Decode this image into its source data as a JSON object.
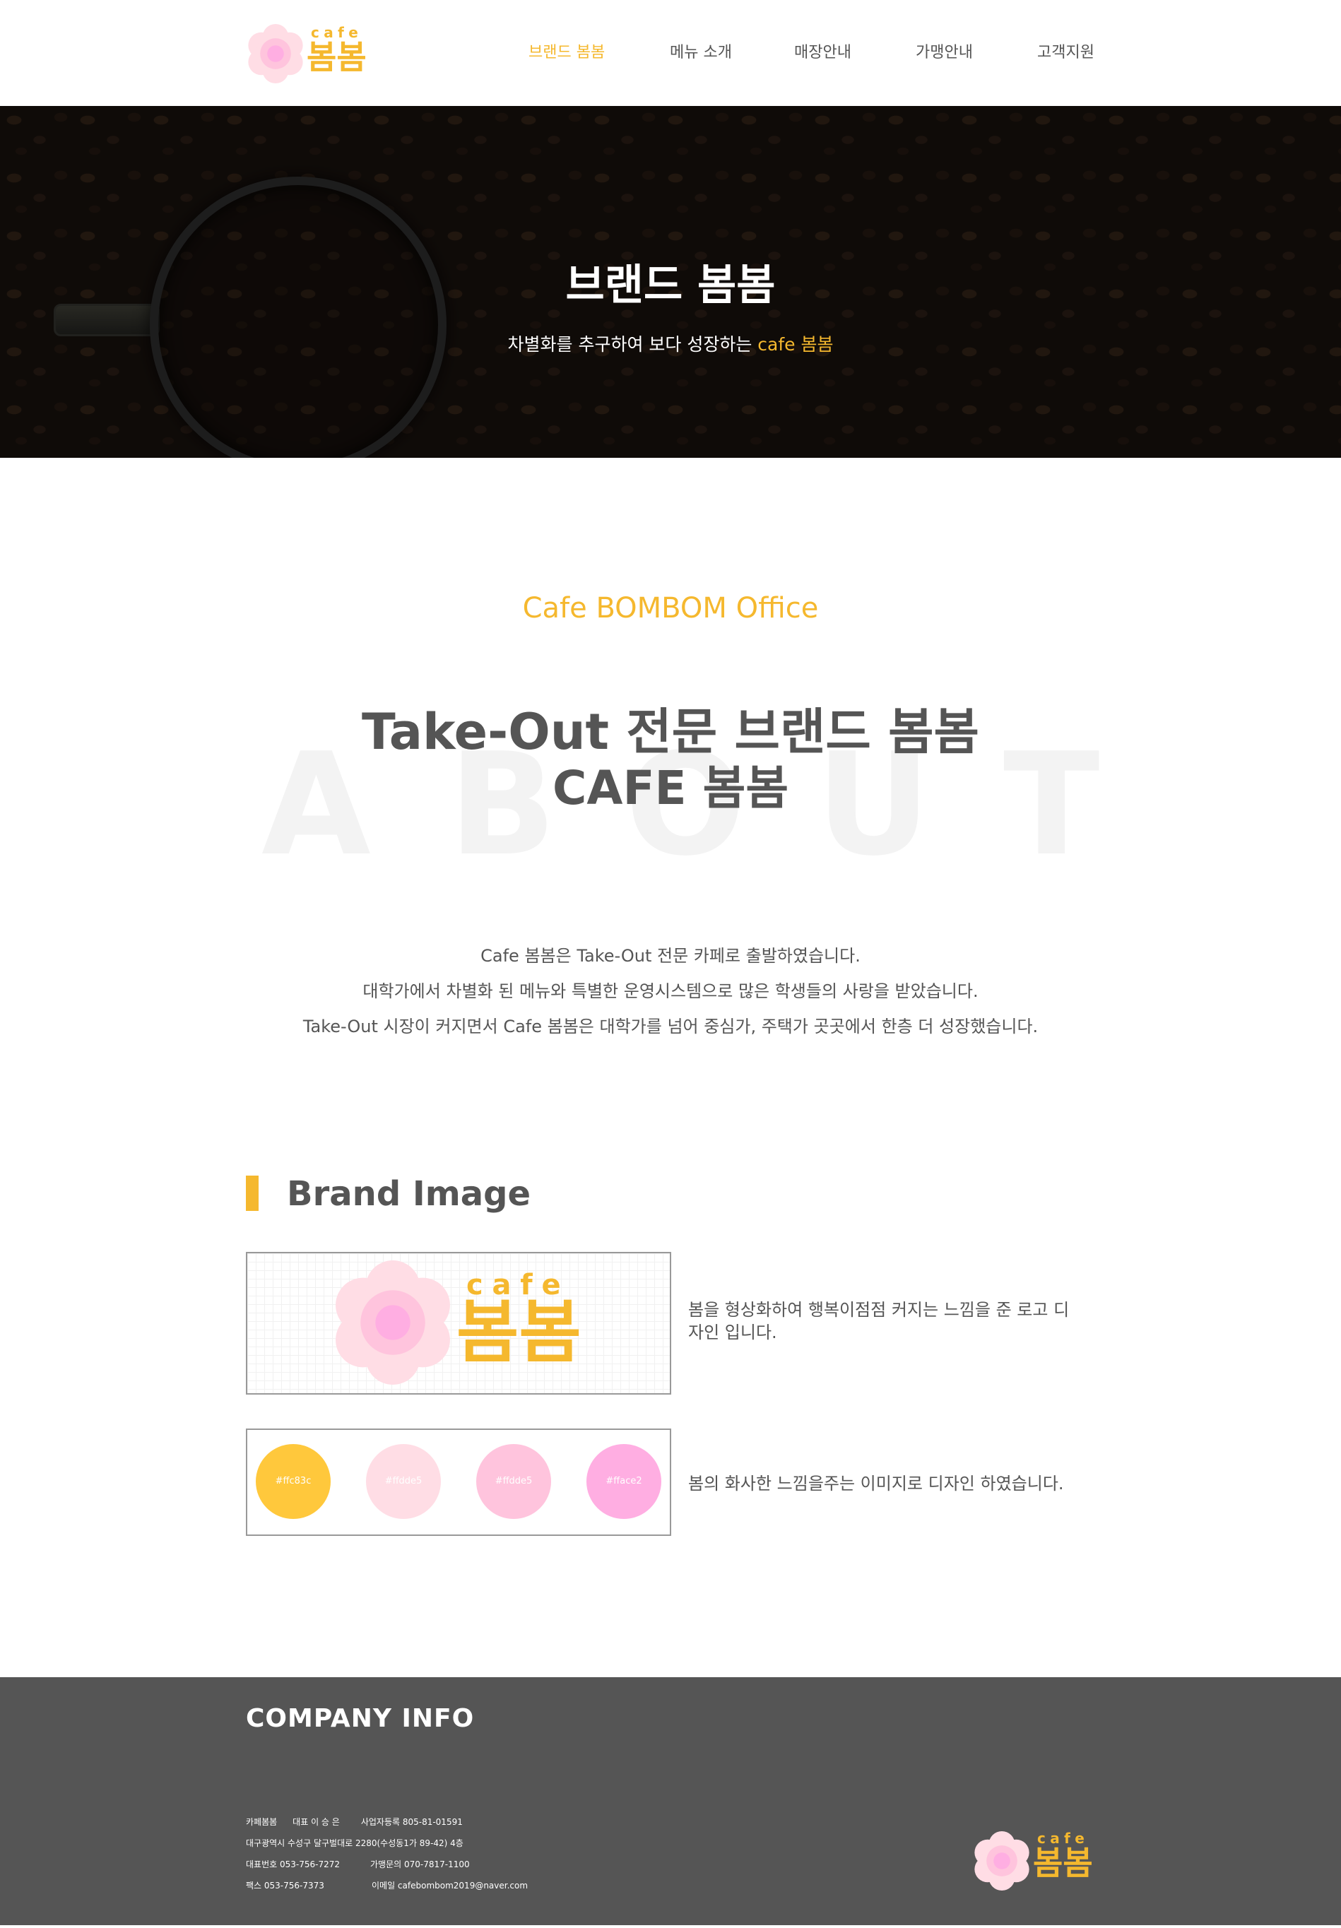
{
  "header": {
    "logo": {
      "cafe": "cafe",
      "name": "봄봄"
    },
    "nav": [
      {
        "label": "브랜드 봄봄",
        "active": true
      },
      {
        "label": "메뉴 소개",
        "active": false
      },
      {
        "label": "매장안내",
        "active": false
      },
      {
        "label": "가맹안내",
        "active": false
      },
      {
        "label": "고객지원",
        "active": false
      }
    ]
  },
  "hero": {
    "title": "브랜드 봄봄",
    "subtitle_prefix": "차별화를 추구하여 보다 성장하는 ",
    "subtitle_accent": "cafe 봄봄"
  },
  "about": {
    "eyebrow": "Cafe BOMBOM Office",
    "background_word": [
      "A",
      "B",
      "O",
      "U",
      "T"
    ],
    "title_line1": "Take-Out 전문 브랜드 봄봄",
    "title_line2": "CAFE 봄봄",
    "lines": [
      "Cafe 봄봄은 Take-Out 전문 카페로 출발하였습니다.",
      "대학가에서 차별화 된 메뉴와 특별한 운영시스템으로 많은 학생들의 사랑을 받았습니다.",
      "Take-Out 시장이 커지면서 Cafe 봄봄은 대학가를 넘어 중심가, 주택가 곳곳에서 한층 더 성장했습니다."
    ]
  },
  "brand_image": {
    "title": "Brand Image",
    "logo_description": "봄을 형상화하여 행복이점점 커지는 느낌을 준 로고 디자인 입니다.",
    "swatches": [
      {
        "label": "#ffc83c",
        "color": "#ffc83c"
      },
      {
        "label": "#ffdde5",
        "color": "#ffdde5"
      },
      {
        "label": "#ffdde5",
        "color": "#ffc4dd"
      },
      {
        "label": "#fface2",
        "color": "#ffaee2"
      }
    ],
    "swatch_description": "봄의 화사한 느낌을주는 이미지로 디자인 하였습니다."
  },
  "footer": {
    "title": "COMPANY INFO",
    "company": "카페봄봄",
    "ceo": "대표 이 승 은",
    "business_no": "사업자등록 805-81-01591",
    "address": "대구광역시 수성구 달구벌대로 2280(수성동1가 89-42) 4층",
    "phone": "대표번호 053-756-7272",
    "franchise_phone": "가맹문의 070-7817-1100",
    "fax": "팩스 053-756-7373",
    "email": "이메일 cafebombom2019@naver.com"
  },
  "colors": {
    "accent": "#f5b82e",
    "text": "#555555",
    "footer_bg": "#555555",
    "flower_outer": "#ffdde5",
    "flower_mid": "#ffc4dd",
    "flower_inner": "#ffaee2"
  }
}
